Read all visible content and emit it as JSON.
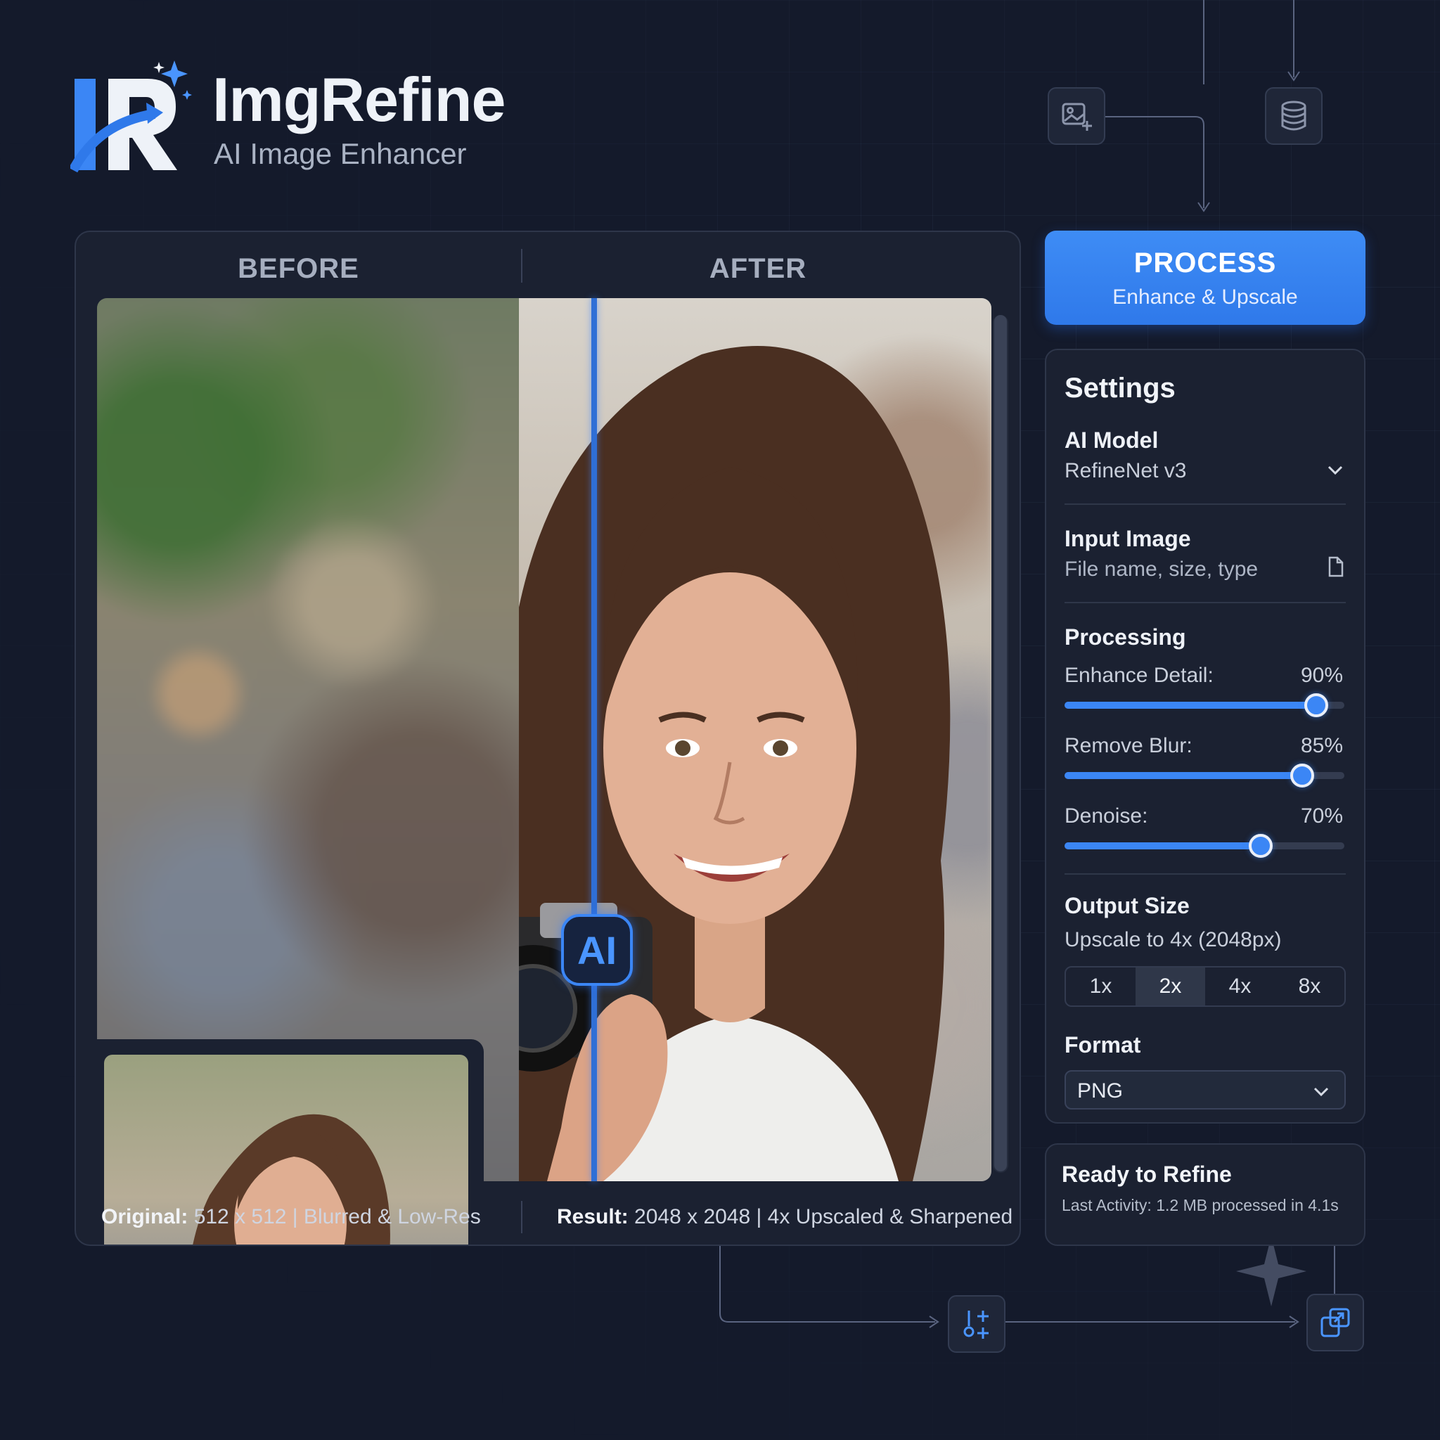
{
  "app": {
    "title": "ImgRefine",
    "subtitle": "AI Image Enhancer"
  },
  "compare": {
    "before_label": "BEFORE",
    "after_label": "AFTER",
    "ai_badge": "AI",
    "caption_left": {
      "label": "Original:",
      "text": "512 x 512 | Blurred & Low-Res"
    },
    "caption_right": {
      "label": "Result:",
      "text": "2048 x 2048 | 4x Upscaled & Sharpened"
    }
  },
  "process_button": {
    "label": "PROCESS",
    "sublabel": "Enhance & Upscale"
  },
  "settings": {
    "title": "Settings",
    "ai_model": {
      "label": "AI Model",
      "value": "RefineNet v3"
    },
    "input_image": {
      "label": "Input Image",
      "value": "File name, size, type"
    },
    "processing": {
      "label": "Processing",
      "sliders": [
        {
          "label": "Enhance Detail:",
          "value_text": "90%",
          "value": 0.9
        },
        {
          "label": "Remove Blur:",
          "value_text": "85%",
          "value": 0.85
        },
        {
          "label": "Denoise:",
          "value_text": "70%",
          "value": 0.7
        }
      ]
    },
    "output_size": {
      "label": "Output Size",
      "value": "Upscale to 4x (2048px)",
      "options": [
        "1x",
        "2x",
        "4x",
        "8x"
      ],
      "selected": "2x"
    },
    "format": {
      "label": "Format",
      "value": "PNG"
    }
  },
  "status": {
    "title": "Ready to Refine",
    "detail": "Last Activity: 1.2 MB processed in 4.1s"
  },
  "colors": {
    "background": "#141a2b",
    "panel": "#1b2131",
    "accent": "#3b86f5",
    "text": "#e8ecf4"
  },
  "icons": [
    "image-add-icon",
    "database-icon",
    "chevron-down-icon",
    "file-icon",
    "adjust-icon",
    "export-icon",
    "sparkle-icon"
  ]
}
